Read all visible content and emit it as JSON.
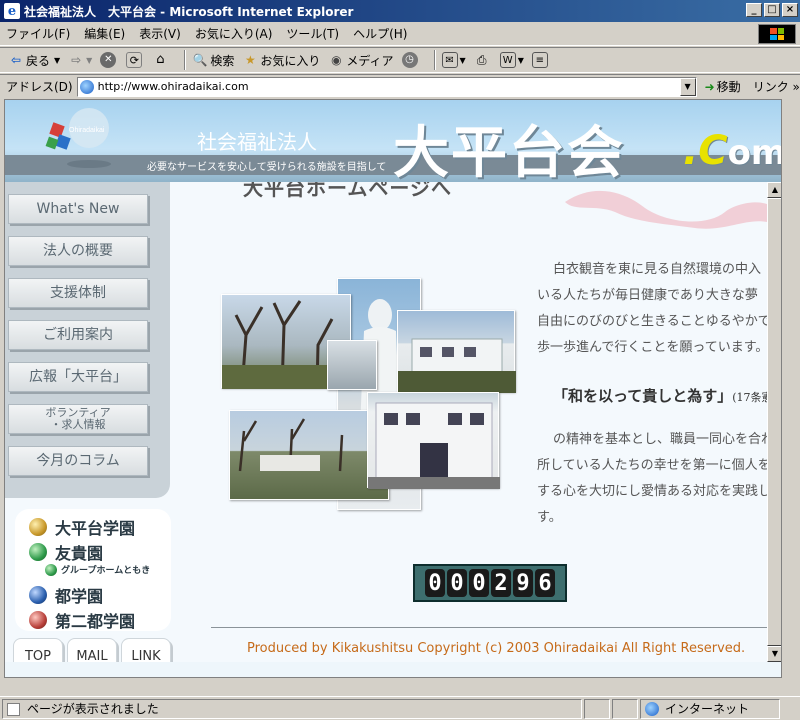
{
  "window": {
    "title": "社会福祉法人　大平台会 - Microsoft Internet Explorer",
    "icon_letter": "e"
  },
  "menu": [
    "ファイル(F)",
    "編集(E)",
    "表示(V)",
    "お気に入り(A)",
    "ツール(T)",
    "ヘルプ(H)"
  ],
  "toolbar": {
    "back": "戻る",
    "search": "検索",
    "favorites": "お気に入り",
    "media": "メディア"
  },
  "address": {
    "label": "アドレス(D)",
    "url": "http://www.ohiradaikai.com",
    "go": "移動",
    "links": "リンク"
  },
  "banner": {
    "org_type": "社会福祉法人",
    "tagline": "必要なサービスを安心して受けられる施設を目指して",
    "name": "大平台会",
    "dot_c": ".C",
    "om": "om",
    "logo_text": "Ohiradaikai"
  },
  "nav": [
    {
      "label": "What's New"
    },
    {
      "label": "法人の概要"
    },
    {
      "label": "支援体制"
    },
    {
      "label": "ご利用案内"
    },
    {
      "label": "広報「大平台」"
    },
    {
      "label": "ボランティア\n・求人情報"
    },
    {
      "label": "今月のコラム"
    }
  ],
  "facilities": [
    {
      "name": "大平台学園",
      "color": "#c8982a"
    },
    {
      "name": "友貴園",
      "color": "#2e9a4a"
    },
    {
      "name": "グループホームともき",
      "color": "#2e9a4a"
    },
    {
      "name": "都学園",
      "color": "#2a5fae"
    },
    {
      "name": "第二都学園",
      "color": "#b8403a"
    }
  ],
  "bottom_buttons": {
    "top": "TOP",
    "mail": "MAIL",
    "link": "LINK"
  },
  "main": {
    "heading": "大平台ホームページへ",
    "para1": [
      "白衣観音を東に見る自然環境の中入",
      "いる人たちが毎日健康であり大きな夢",
      "自由にのびのびと生きることゆるやかで",
      "歩一歩進んで行くことを願っています。"
    ],
    "quote": "「和を以って貴しと為す」",
    "quote_source": "(17条憲",
    "para2": [
      "の精神を基本とし、職員一同心を合わ",
      "所している人たちの幸せを第一に個人を",
      "する心を大切にし愛情ある対応を実践し",
      "す。"
    ],
    "counter": "000296",
    "footer": "Produced by Kikakushitsu Copyright (c) 2003 Ohiradaikai All Right Reserved."
  },
  "status": {
    "text": "ページが表示されました",
    "zone": "インターネット"
  }
}
